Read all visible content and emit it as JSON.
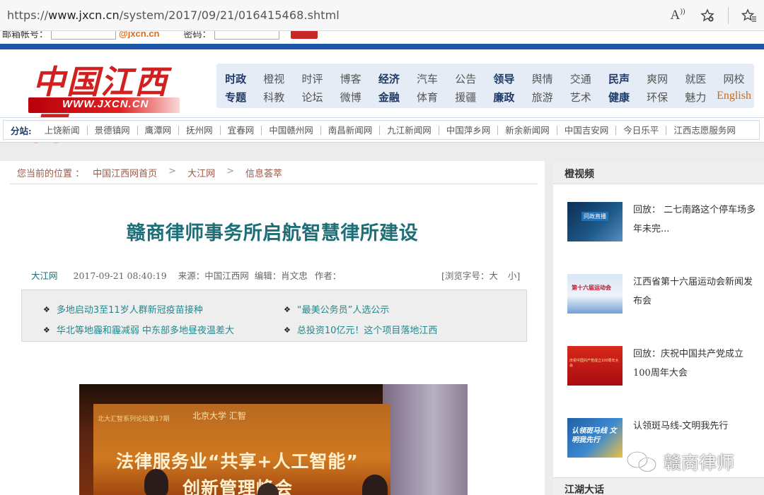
{
  "browser": {
    "url_scheme": "https://",
    "url_host": "www.jxcn.cn",
    "url_path": "/system/2017/09/21/016415468.shtml",
    "read_aloud_icon": "Aʾ",
    "favorite_icon": "star-plus"
  },
  "login": {
    "email_label": "邮箱帐号：",
    "email_domain": "@jxcn.cn",
    "password_label": "密码："
  },
  "logo": {
    "cn_text": "中国江西网",
    "url_text": "WWW.JXCN.CN"
  },
  "nav": {
    "row1": [
      {
        "label": "时政",
        "bold": true
      },
      {
        "label": "橙视",
        "bold": false
      },
      {
        "label": "时评",
        "bold": false
      },
      {
        "label": "博客",
        "bold": false
      },
      {
        "label": "经济",
        "bold": true
      },
      {
        "label": "汽车",
        "bold": false
      },
      {
        "label": "公告",
        "bold": false
      },
      {
        "label": "领导",
        "bold": true
      },
      {
        "label": "舆情",
        "bold": false
      },
      {
        "label": "交通",
        "bold": false
      },
      {
        "label": "民声",
        "bold": true
      },
      {
        "label": "爽网",
        "bold": false
      },
      {
        "label": "就医",
        "bold": false
      },
      {
        "label": "网校",
        "bold": false
      }
    ],
    "row2": [
      {
        "label": "专题",
        "bold": true
      },
      {
        "label": "科教",
        "bold": false
      },
      {
        "label": "论坛",
        "bold": false
      },
      {
        "label": "微博",
        "bold": false
      },
      {
        "label": "金融",
        "bold": true
      },
      {
        "label": "体育",
        "bold": false
      },
      {
        "label": "援疆",
        "bold": false
      },
      {
        "label": "廉政",
        "bold": true
      },
      {
        "label": "旅游",
        "bold": false
      },
      {
        "label": "艺术",
        "bold": false
      },
      {
        "label": "健康",
        "bold": true
      },
      {
        "label": "环保",
        "bold": false
      },
      {
        "label": "魅力",
        "bold": false
      },
      {
        "label": "English",
        "bold": false,
        "english": true
      }
    ]
  },
  "substations": {
    "label": "分站:",
    "items": [
      "上饶新闻",
      "景德镇网",
      "鹰潭网",
      "抚州网",
      "宜春网",
      "中国赣州网",
      "南昌新闻网",
      "九江新闻网",
      "中国萍乡网",
      "新余新闻网",
      "中国吉安网",
      "今日乐平",
      "江西志愿服务网"
    ]
  },
  "breadcrumb": {
    "prefix": "您当前的位置 ：",
    "items": [
      "中国江西网首页",
      "大江网",
      "信息荟萃"
    ],
    "separator": ">"
  },
  "article": {
    "title": "赣商律师事务所启航智慧律所建设",
    "source_site": "大江网",
    "datetime": "2017-09-21 08:40:19",
    "source": "来源：中国江西网",
    "editor": "编辑：肖文忠",
    "author": "作者：",
    "font_size_label": "[浏览字号：大",
    "font_size_small": "小]"
  },
  "related_news": [
    "多地启动3至11岁人群新冠疫苗接种",
    "“最美公务员”人选公示",
    "华北等地霾和霾减弱 中东部多地昼夜温差大",
    "总投资10亿元！这个项目落地江西"
  ],
  "photo": {
    "small_line": "北大汇智系列论坛第17期",
    "logos_line": "北京大学   汇智",
    "headline1": "法律服务业“共享+人工智能”",
    "headline2": "创新管理峰会"
  },
  "sidebar": {
    "title": "橙视频",
    "videos": [
      {
        "text": "回放：   二七南路这个停车场多年未完...",
        "thumb_text": "问政直播",
        "thumb_color": "#1e5a8a"
      },
      {
        "text": "江西省第十六届运动会新闻发布会",
        "thumb_text": "第十六届运动会",
        "thumb_color": "#e8eef6"
      },
      {
        "text": "回放：庆祝中国共产党成立100周年大会",
        "thumb_text": "庆祝中国共产党成立100周年大会",
        "thumb_color": "#c01818"
      },
      {
        "text": "认领斑马线-文明我先行",
        "thumb_text": "认领斑马线 文明我先行",
        "thumb_color": "#2a6fb0"
      }
    ],
    "second_title": "江湖大话"
  },
  "watermark": {
    "text": "赣商律师"
  }
}
